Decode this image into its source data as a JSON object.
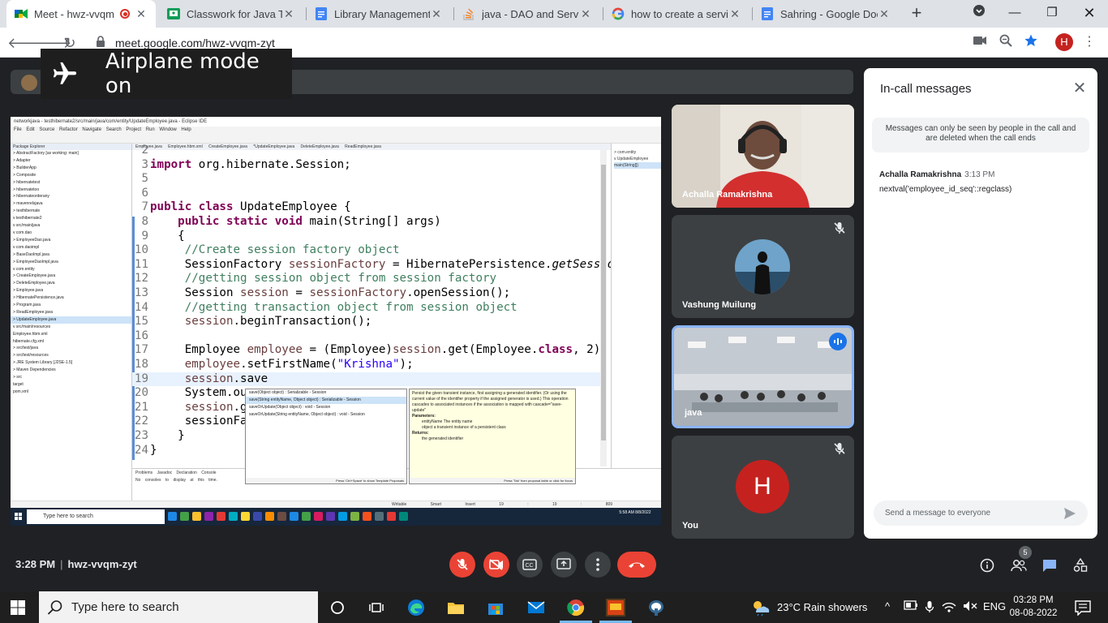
{
  "browser": {
    "tabs": [
      {
        "label": "Meet - hwz-vvqm",
        "icon": "meet-icon",
        "active": true,
        "recording": true
      },
      {
        "label": "Classwork for Java Tra",
        "icon": "classroom-icon"
      },
      {
        "label": "Library Management S",
        "icon": "docs-icon"
      },
      {
        "label": "java - DAO and Service",
        "icon": "stackoverflow-icon"
      },
      {
        "label": "how to create a service",
        "icon": "google-icon"
      },
      {
        "label": "Sahring - Google Docs",
        "icon": "docs-icon"
      }
    ],
    "url": "meet.google.com/hwz-vvqm-zyt",
    "profile_initial": "H"
  },
  "toast": {
    "message": "Airplane mode on"
  },
  "eclipse": {
    "title": "networkjava - testhibernate2/src/main/java/com/entity/UpdateEmployee.java - Eclipse IDE",
    "menu": "File Edit Source Refactor Navigate Search Project Run Window Help",
    "package_explorer_title": "Package Explorer",
    "tree": [
      "> AbstractFactory [as working: main]",
      "> Adapter",
      "> BuilderApp",
      "> Composite",
      "> hibernatetest",
      "> hibernatetoo",
      "> hibernateorderany",
      "> mavenrelsjava",
      "> testhibernate",
      "v testhibernate2",
      "  v src/main/java",
      "    v com.dao",
      "      > EmployeeDao.java",
      "    v com.daoimpl",
      "      > BaseDaoImpl.java",
      "      > EmployeeDaoImpl.java",
      "    v com.entity",
      "      > CreateEmployee.java",
      "      > DeleteEmployee.java",
      "      > Employee.java",
      "      > HibernatePersistence.java",
      "      > Program.java",
      "      > ReadEmployee.java",
      "      > UpdateEmployee.java",
      "  v src/main/resources",
      "      Employee.hbm.xml",
      "      hibernate.cfg.xml",
      "  > src/test/java",
      "  > src/test/resources",
      "  > JRE System Library [J2SE-1.5]",
      "  > Maven Dependencies",
      "  > src",
      "    target",
      "    pom.xml"
    ],
    "editor_tabs": "Employee.java  Employee.hbm.xml  CreateEmployee.java  *UpdateEmployee.java  DeleteEmployee.java  ReadEmployee.java",
    "code_lines": [
      {
        "n": "2",
        "html": ""
      },
      {
        "n": "3",
        "html": "<span class='kw'>import</span> org.hibernate.Session;"
      },
      {
        "n": "5",
        "html": ""
      },
      {
        "n": "6",
        "html": ""
      },
      {
        "n": "7",
        "html": "<span class='kw'>public class</span> UpdateEmployee {"
      },
      {
        "n": "8",
        "html": "    <span class='kw'>public static void</span> main(String[] args)"
      },
      {
        "n": "9",
        "html": "    {"
      },
      {
        "n": "10",
        "html": "     <span class='cm'>//Create session factory object</span>"
      },
      {
        "n": "11",
        "html": "     SessionFactory <span class='loc'>sessionFactory</span> = HibernatePersistence.<span class='ital'>getSessio</span>"
      },
      {
        "n": "12",
        "html": "     <span class='cm'>//getting session object from session factory</span>"
      },
      {
        "n": "13",
        "html": "     Session <span class='loc'>session</span> = <span class='loc'>sessionFactory</span>.openSession();"
      },
      {
        "n": "14",
        "html": "     <span class='cm'>//getting transaction object from session object</span>"
      },
      {
        "n": "15",
        "html": "     <span class='loc'>session</span>.beginTransaction();"
      },
      {
        "n": "16",
        "html": ""
      },
      {
        "n": "17",
        "html": "     Employee <span class='loc'>employee</span> = (Employee)<span class='loc'>session</span>.get(Employee.<span class='kw'>class</span>, 2);"
      },
      {
        "n": "18",
        "html": "     <span class='loc'>employee</span>.setFirstName(<span class='str'>\"Krishna\"</span>);"
      },
      {
        "n": "19",
        "html": "     <span class='loc'>session</span>.save"
      },
      {
        "n": "20",
        "html": "     System.ou"
      },
      {
        "n": "21",
        "html": "     <span class='loc'>session</span>.g"
      },
      {
        "n": "22",
        "html": "     sessionFa"
      },
      {
        "n": "23",
        "html": "    }"
      },
      {
        "n": "24",
        "html": "}"
      }
    ],
    "content_assist": [
      "save(Object object) : Serializable - Session",
      "save(String entityName, Object object) : Serializable - Session",
      "saveOrUpdate(Object object) : void - Session",
      "saveOrUpdate(String entityName, Object object) : void - Session"
    ],
    "content_assist_footer": "Press 'Ctrl+Space' to show Template Proposals",
    "javadoc": "Persist the given transient instance, first assigning a generated identifier. (Or using the current value of the identifier property if the assigned generator is used.) This operation cascades to associated instances if the association is mapped with cascade=\"save-update\"",
    "javadoc_params_label": "Parameters:",
    "javadoc_param1": "entityName The entity name",
    "javadoc_param2": "object a transient instance of a persistent class",
    "javadoc_returns_label": "Returns:",
    "javadoc_returns": "the generated identifier",
    "javadoc_footer": "Press 'Tab' from proposal table or click for focus",
    "outline": [
      "> com.entity",
      "v UpdateEmployee",
      "   main(String[])"
    ],
    "bottom_tabs": "Problems  Javadoc  Declaration  Console",
    "console_msg": "No consoles to display at this time.",
    "status": "Writable  Smart Insert  19 : 19 : 809",
    "inner_search": "Type here to search",
    "inner_clock": "5:58 AM 8/8/2022"
  },
  "tiles": [
    {
      "name": "Achalla Ramakrishna",
      "muted": false
    },
    {
      "name": "Vashung Muilung",
      "muted": true
    },
    {
      "name": "java",
      "muted": false,
      "speaking": true
    },
    {
      "name": "You",
      "muted": true,
      "initial": "H"
    }
  ],
  "chat": {
    "title": "In-call messages",
    "notice": "Messages can only be seen by people in the call and are deleted when the call ends",
    "sender": "Achalla Ramakrishna",
    "time": "3:13 PM",
    "message": "nextval('employee_id_seq'::regclass)",
    "input_placeholder": "Send a message to everyone"
  },
  "meeting": {
    "time": "3:28 PM",
    "code": "hwz-vvqm-zyt",
    "people_count": "5"
  },
  "taskbar": {
    "search_placeholder": "Type here to search",
    "weather": "23°C  Rain showers",
    "language": "ENG",
    "time": "03:28 PM",
    "date": "08-08-2022"
  },
  "colors": {
    "meet_bg": "#202124",
    "tile_bg": "#3c4043",
    "danger": "#ea4335",
    "accent": "#1a73e8"
  }
}
